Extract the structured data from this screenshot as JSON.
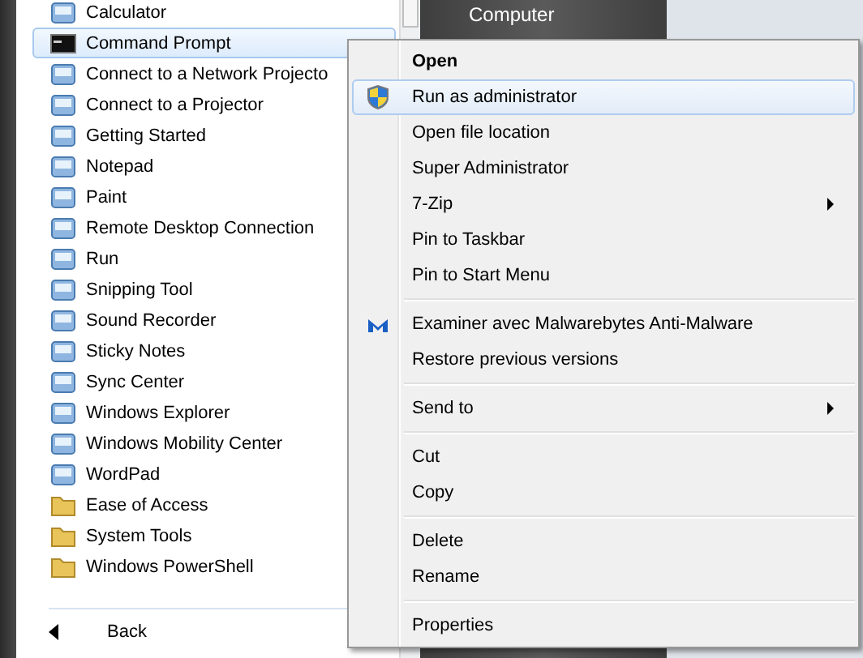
{
  "programs": [
    {
      "label": "Calculator",
      "kind": "app",
      "selected": false
    },
    {
      "label": "Command Prompt",
      "kind": "console",
      "selected": true
    },
    {
      "label": "Connect to a Network Projecto",
      "kind": "app",
      "selected": false
    },
    {
      "label": "Connect to a Projector",
      "kind": "app",
      "selected": false
    },
    {
      "label": "Getting Started",
      "kind": "app",
      "selected": false
    },
    {
      "label": "Notepad",
      "kind": "app",
      "selected": false
    },
    {
      "label": "Paint",
      "kind": "app",
      "selected": false
    },
    {
      "label": "Remote Desktop Connection",
      "kind": "app",
      "selected": false
    },
    {
      "label": "Run",
      "kind": "app",
      "selected": false
    },
    {
      "label": "Snipping Tool",
      "kind": "app",
      "selected": false
    },
    {
      "label": "Sound Recorder",
      "kind": "app",
      "selected": false
    },
    {
      "label": "Sticky Notes",
      "kind": "app",
      "selected": false
    },
    {
      "label": "Sync Center",
      "kind": "app",
      "selected": false
    },
    {
      "label": "Windows Explorer",
      "kind": "app",
      "selected": false
    },
    {
      "label": "Windows Mobility Center",
      "kind": "app",
      "selected": false
    },
    {
      "label": "WordPad",
      "kind": "app",
      "selected": false
    },
    {
      "label": "Ease of Access",
      "kind": "folder",
      "selected": false
    },
    {
      "label": "System Tools",
      "kind": "folder",
      "selected": false
    },
    {
      "label": "Windows PowerShell",
      "kind": "folder",
      "selected": false
    }
  ],
  "back": {
    "label": "Back"
  },
  "right_panel": {
    "label": "Computer"
  },
  "context_menu": [
    [
      {
        "label": "Open",
        "kind": "plain",
        "default": true,
        "submenu": false,
        "selected": false
      },
      {
        "label": "Run as administrator",
        "kind": "elevated",
        "default": false,
        "submenu": false,
        "selected": true
      },
      {
        "label": "Open file location",
        "kind": "plain",
        "default": false,
        "submenu": false,
        "selected": false
      },
      {
        "label": "Super Administrator",
        "kind": "plain",
        "default": false,
        "submenu": false,
        "selected": false
      },
      {
        "label": "7-Zip",
        "kind": "plain",
        "default": false,
        "submenu": true,
        "selected": false
      },
      {
        "label": "Pin to Taskbar",
        "kind": "plain",
        "default": false,
        "submenu": false,
        "selected": false
      },
      {
        "label": "Pin to Start Menu",
        "kind": "plain",
        "default": false,
        "submenu": false,
        "selected": false
      }
    ],
    [
      {
        "label": "Examiner avec Malwarebytes Anti-Malware",
        "kind": "scanner",
        "default": false,
        "submenu": false,
        "selected": false
      },
      {
        "label": "Restore previous versions",
        "kind": "plain",
        "default": false,
        "submenu": false,
        "selected": false
      }
    ],
    [
      {
        "label": "Send to",
        "kind": "plain",
        "default": false,
        "submenu": true,
        "selected": false
      }
    ],
    [
      {
        "label": "Cut",
        "kind": "plain",
        "default": false,
        "submenu": false,
        "selected": false
      },
      {
        "label": "Copy",
        "kind": "plain",
        "default": false,
        "submenu": false,
        "selected": false
      }
    ],
    [
      {
        "label": "Delete",
        "kind": "plain",
        "default": false,
        "submenu": false,
        "selected": false
      },
      {
        "label": "Rename",
        "kind": "plain",
        "default": false,
        "submenu": false,
        "selected": false
      }
    ],
    [
      {
        "label": "Properties",
        "kind": "plain",
        "default": false,
        "submenu": false,
        "selected": false
      }
    ]
  ]
}
